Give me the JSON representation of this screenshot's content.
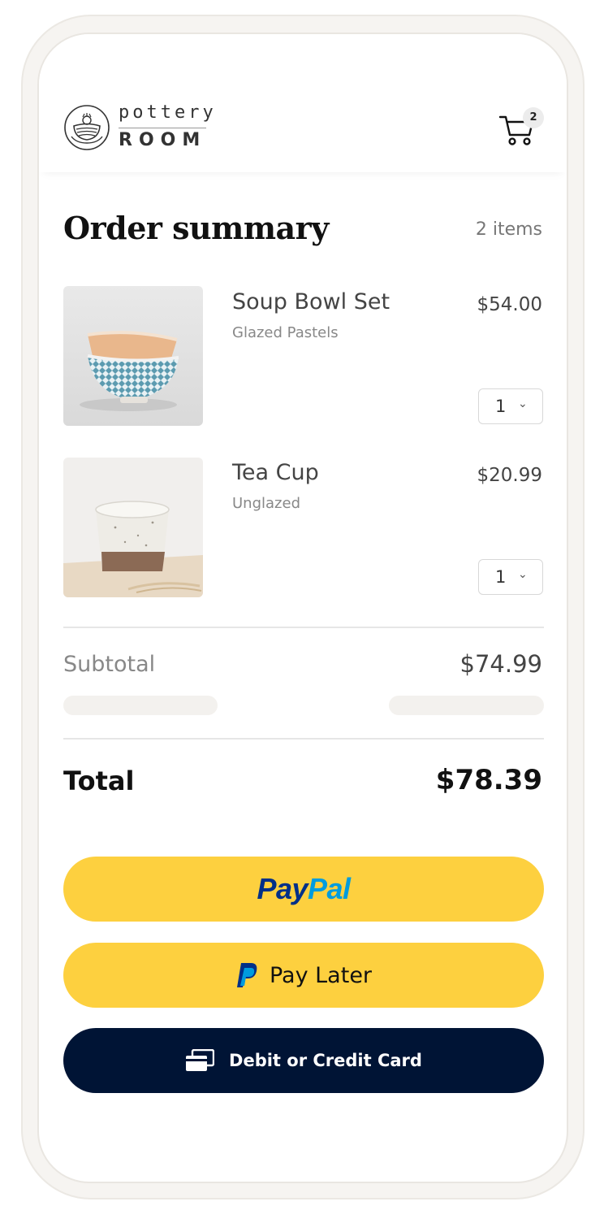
{
  "brand": {
    "line1": "pottery",
    "line2": "ROOM"
  },
  "cart": {
    "count": "2",
    "icon": "cart-icon"
  },
  "summary": {
    "title": "Order summary",
    "item_count": "2 items"
  },
  "items": [
    {
      "name": "Soup Bowl Set",
      "variant": "Glazed Pastels",
      "price": "$54.00",
      "qty": "1"
    },
    {
      "name": "Tea Cup",
      "variant": "Unglazed",
      "price": "$20.99",
      "qty": "1"
    }
  ],
  "totals": {
    "subtotal_label": "Subtotal",
    "subtotal_value": "$74.99",
    "total_label": "Total",
    "total_value": "$78.39"
  },
  "payment": {
    "paypal_part1": "Pay",
    "paypal_part2": "Pal",
    "paylater_label": "Pay Later",
    "card_label": "Debit or Credit Card"
  },
  "colors": {
    "paypal_yellow": "#fdd03f",
    "paypal_navy": "#013088",
    "paypal_blue": "#009cde",
    "card_bg": "#001435"
  }
}
